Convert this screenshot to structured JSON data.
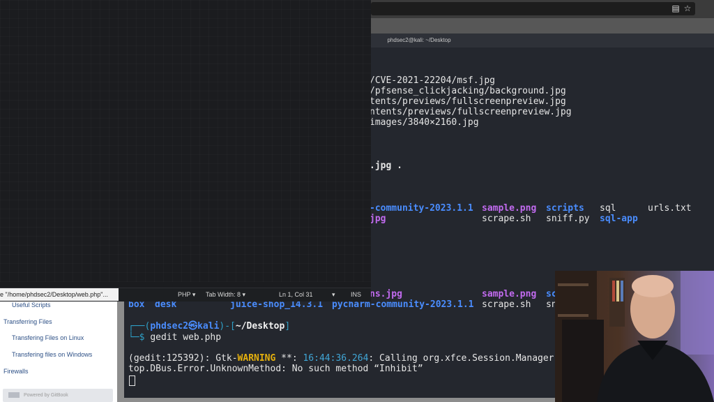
{
  "terminal": {
    "title": "phdsec2@kali: ~/Desktop",
    "lines": [
      "/CVE-2021-22204/msf.jpg",
      "/pfsense_clickjacking/background.jpg",
      "tents/previews/fullscreenpreview.jpg",
      "ntents/previews/fullscreenpreview.jpg",
      "images/3840×2160.jpg"
    ],
    "cmd_fragment": ".jpg .",
    "ls1": {
      "community": "-community-2023.1.1",
      "sample": "sample.png",
      "scripts": "scripts",
      "sql": "sql",
      "urls": "urls.txt",
      "jpg": "jpg",
      "scrape": "scrape.sh",
      "sniff": "sniff.py",
      "sqlapp": "sql-app"
    },
    "ls2": {
      "nsjpg": "ns.jpg",
      "sample": "sample.png",
      "sc": "sc",
      "box": "box",
      "desk": "desk",
      "juice": "juice-shop_14.3.1",
      "pycharm": "pycharm-community-2023.1.1",
      "scrape": "scrape.sh",
      "sn": "sn"
    },
    "prompt": {
      "open": "┌──(",
      "user": "phdsec2㉿kali",
      "mid": ")-[",
      "path": "~/Desktop",
      "close": "]",
      "arrow": "└─$",
      "command": "gedit web.php"
    },
    "warn": {
      "prefix": "(gedit:125392): Gtk-",
      "level": "WARNING",
      "stars": " **: ",
      "time": "16:44:36.264",
      "msg": ": Calling org.xfce.Session.Manager.I",
      "line2": "top.DBus.Error.UnknownMethod: No such method “Inhibit”"
    }
  },
  "gedit": {
    "status_message": "e \"/home/phdsec2/Desktop/web.php\"...",
    "language": "PHP",
    "tab_width": "Tab Width: 8",
    "position": "Ln 1, Col 31",
    "mode": "INS"
  },
  "sidebar": {
    "items": [
      "Useful Scripts",
      "Transferring Files",
      "Transfering Files on Linux",
      "Transfering files on Windows",
      "Firewalls"
    ],
    "gitbook": "Powered by GitBook"
  },
  "icons": {
    "reader": "reader-view-icon",
    "bookmark": "bookmark-star-icon",
    "menu": "dropdown-arrow-icon"
  },
  "colors": {
    "terminal_bg": "#24272e",
    "directory": "#4a8dff",
    "image_file": "#c26bf0",
    "prompt": "#2ea0c8",
    "warning": "#e5b00d"
  }
}
